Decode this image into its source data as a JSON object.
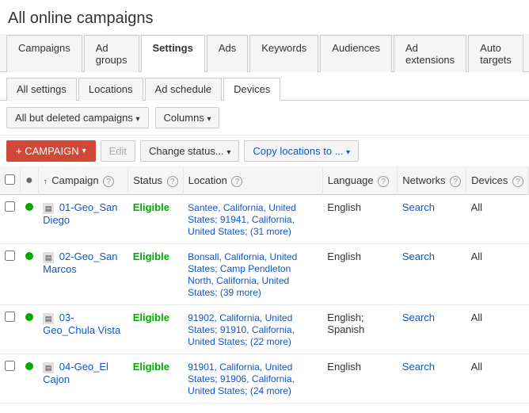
{
  "page": {
    "title": "All online campaigns"
  },
  "mainTabs": [
    {
      "label": "Campaigns",
      "active": false
    },
    {
      "label": "Ad groups",
      "active": false
    },
    {
      "label": "Settings",
      "active": true
    },
    {
      "label": "Ads",
      "active": false
    },
    {
      "label": "Keywords",
      "active": false
    },
    {
      "label": "Audiences",
      "active": false
    },
    {
      "label": "Ad extensions",
      "active": false
    },
    {
      "label": "Auto targets",
      "active": false
    }
  ],
  "subTabs": [
    {
      "label": "All settings",
      "active": false
    },
    {
      "label": "Locations",
      "active": false
    },
    {
      "label": "Ad schedule",
      "active": false
    },
    {
      "label": "Devices",
      "active": true
    }
  ],
  "toolbar": {
    "filter_label": "All but deleted campaigns",
    "columns_label": "Columns"
  },
  "actions": {
    "campaign_label": "+ CAMPAIGN",
    "edit_label": "Edit",
    "change_status_label": "Change status...",
    "copy_locations_label": "Copy locations to ..."
  },
  "table": {
    "headers": [
      {
        "label": "",
        "type": "checkbox"
      },
      {
        "label": "",
        "type": "dot"
      },
      {
        "label": "Campaign",
        "sortable": true,
        "help": true
      },
      {
        "label": "Status",
        "help": true
      },
      {
        "label": "Location",
        "help": true
      },
      {
        "label": "Language",
        "help": true
      },
      {
        "label": "Networks",
        "help": true
      },
      {
        "label": "Devices",
        "help": true
      }
    ],
    "rows": [
      {
        "campaign": "01-Geo_San Diego",
        "status": "Eligible",
        "location": "Santee, California, United States; 91941, California, United States; (31 more)",
        "language": "English",
        "networks": "Search",
        "devices": "All"
      },
      {
        "campaign": "02-Geo_San Marcos",
        "status": "Eligible",
        "location": "Bonsall, California, United States; Camp Pendleton North, California, United States; (39 more)",
        "language": "English",
        "networks": "Search",
        "devices": "All"
      },
      {
        "campaign": "03-Geo_Chula Vista",
        "status": "Eligible",
        "location": "91902, California, United States; 91910, California, United States; (22 more)",
        "language": "English; Spanish",
        "networks": "Search",
        "devices": "All"
      },
      {
        "campaign": "04-Geo_El Cajon",
        "status": "Eligible",
        "location": "91901, California, United States; 91906, California, United States; (24 more)",
        "language": "English",
        "networks": "Search",
        "devices": "All"
      }
    ]
  }
}
